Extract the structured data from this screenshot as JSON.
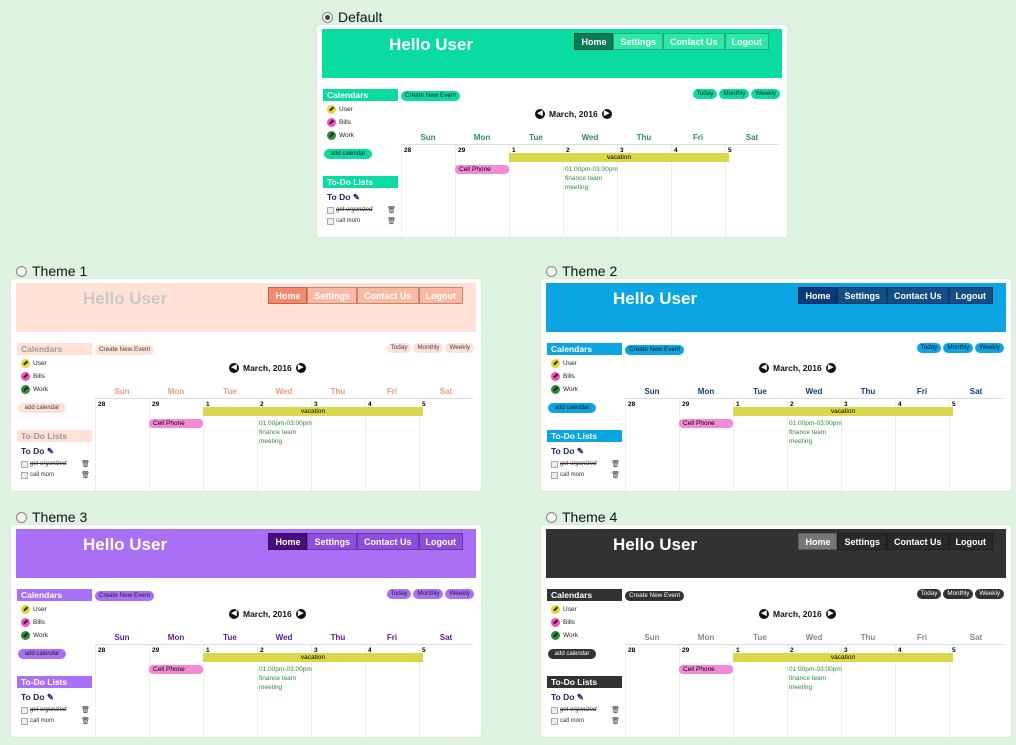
{
  "options": [
    {
      "label": "Default",
      "selected": true
    },
    {
      "label": "Theme 1",
      "selected": false
    },
    {
      "label": "Theme 2",
      "selected": false
    },
    {
      "label": "Theme 3",
      "selected": false
    },
    {
      "label": "Theme 4",
      "selected": false
    }
  ],
  "preview": {
    "hello": "Hello User",
    "nav": [
      "Home",
      "Settings",
      "Contact Us",
      "Logout"
    ],
    "calendars_title": "Calendars",
    "calendars": [
      "User",
      "Bills",
      "Work"
    ],
    "add_calendar": "add calendar",
    "todo_lists_title": "To-Do Lists",
    "todo_heading": "To Do",
    "todo_items": [
      "get organized",
      "call mom"
    ],
    "create_event": "Create New Event",
    "views": [
      "Today",
      "Monthly",
      "Weekly"
    ],
    "month": "March, 2016",
    "weekdays": [
      "Sun",
      "Mon",
      "Tue",
      "Wed",
      "Thu",
      "Fri",
      "Sat"
    ],
    "dates": [
      "28",
      "29",
      "1",
      "2",
      "3",
      "4",
      "5"
    ],
    "events": {
      "vacation": "vacation",
      "cell_phone": "Cell Phone",
      "time": "01:00pm-03:00pm",
      "meeting_title": "finance team",
      "meeting_sub": "meeting"
    }
  },
  "themes": {
    "default": {
      "header": "#09dba1",
      "accent": "#09dba1",
      "day": "#2a8f64",
      "nav_active": "#0b7a57",
      "nav_bg": "#2ee8a6",
      "nav_text": "#ffffff",
      "hello": "#ffffff",
      "bar_text": "#ffffff",
      "btn_text": "#222222"
    },
    "theme1": {
      "header": "#ffe1d6",
      "accent": "#ffe1d6",
      "day": "#f19a79",
      "nav_active": "#f48a6c",
      "nav_bg": "#f9b9a3",
      "nav_text": "#ffffff",
      "hello": "#c8c8c8",
      "bar_text": "#999999",
      "btn_text": "#444444"
    },
    "theme2": {
      "header": "#0ba5e4",
      "accent": "#0ba5e4",
      "day": "#0d3e73",
      "nav_active": "#0a3a7a",
      "nav_bg": "#134f86",
      "nav_text": "#ffffff",
      "hello": "#ffffff",
      "bar_text": "#ffffff",
      "btn_text": "#111111"
    },
    "theme3": {
      "header": "#a96ff5",
      "accent": "#a96ff5",
      "day": "#5b1d8c",
      "nav_active": "#4b0c7e",
      "nav_bg": "#8d4ddd",
      "nav_text": "#ffffff",
      "hello": "#ffffff",
      "bar_text": "#ffffff",
      "btn_text": "#222222"
    },
    "theme4": {
      "header": "#323232",
      "accent": "#323232",
      "day": "#888888",
      "nav_active": "#777777",
      "nav_bg": "#2a2a2a",
      "nav_text": "#ffffff",
      "hello": "#ffffff",
      "bar_text": "#ffffff",
      "btn_text": "#ffffff"
    }
  }
}
